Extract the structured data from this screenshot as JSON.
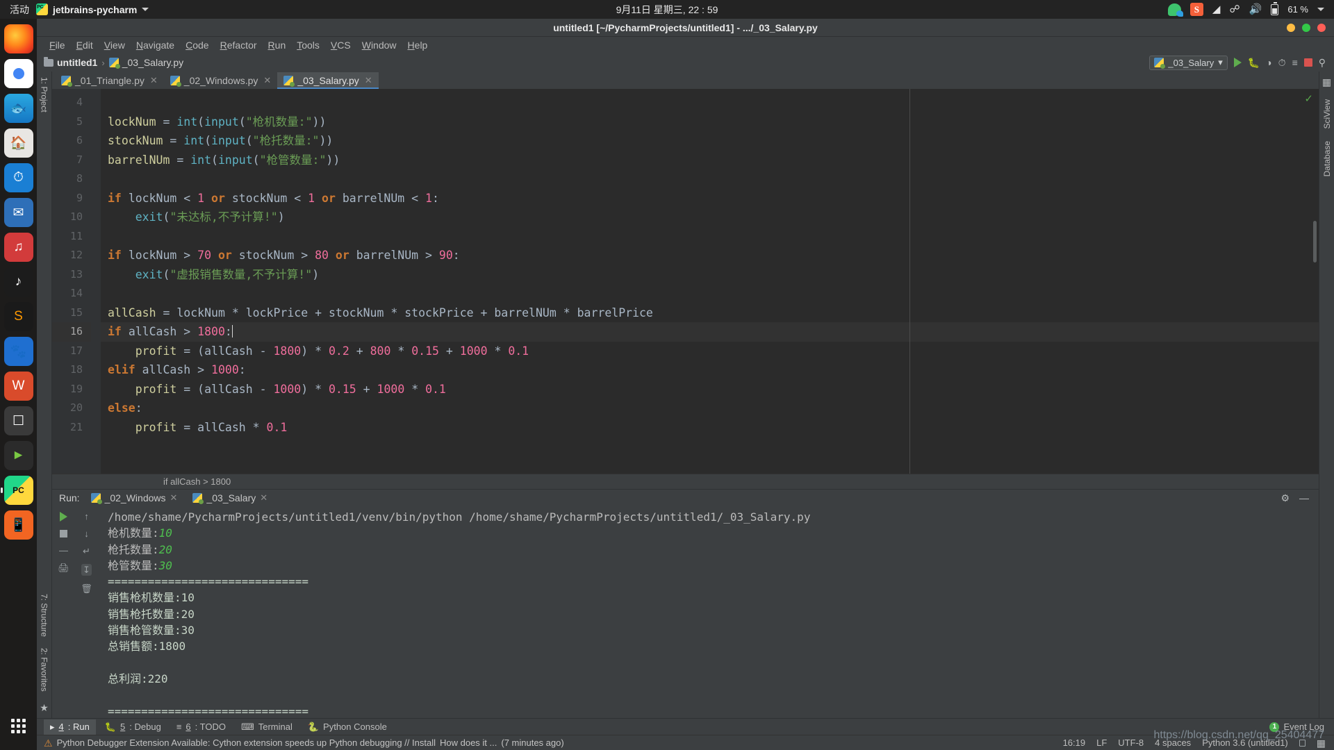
{
  "desktop": {
    "activities": "活动",
    "app_name": "jetbrains-pycharm",
    "clock": "9月11日 星期三, 22 : 59",
    "battery": "61 %",
    "tray": [
      "wechat-icon",
      "sogou-icon",
      "wifi-icon",
      "bluetooth-icon",
      "volume-icon",
      "battery-icon"
    ]
  },
  "dock": {
    "items": [
      {
        "name": "firefox",
        "label": "Firefox"
      },
      {
        "name": "chrome",
        "label": "Google Chrome"
      },
      {
        "name": "dolphin",
        "label": "Dolphin"
      },
      {
        "name": "files",
        "label": "Files"
      },
      {
        "name": "thunder",
        "label": "Thunder"
      },
      {
        "name": "mail",
        "label": "Mail"
      },
      {
        "name": "music",
        "label": "Music"
      },
      {
        "name": "netease",
        "label": "NetEase Music"
      },
      {
        "name": "sublime",
        "label": "Sublime Text"
      },
      {
        "name": "eagle",
        "label": "Eagle"
      },
      {
        "name": "wps",
        "label": "WPS"
      },
      {
        "name": "screenshot",
        "label": "Screenshot"
      },
      {
        "name": "video",
        "label": "Video Player"
      },
      {
        "name": "pycharm",
        "label": "PyCharm"
      },
      {
        "name": "xiaomi",
        "label": "Mi"
      }
    ],
    "show_apps": "Show Applications"
  },
  "ide": {
    "title": "untitled1 [~/PycharmProjects/untitled1] - .../_03_Salary.py",
    "menu": [
      "File",
      "Edit",
      "View",
      "Navigate",
      "Code",
      "Refactor",
      "Run",
      "Tools",
      "VCS",
      "Window",
      "Help"
    ],
    "breadcrumb": {
      "project": "untitled1",
      "file": "_03_Salary.py",
      "separator": "›"
    },
    "run_config": {
      "name": "_03_Salary",
      "caret": "▾"
    },
    "toolbar_icons": [
      "run-icon",
      "debug-icon",
      "coverage-icon",
      "profile-icon",
      "run-with-args-icon",
      "stop-icon",
      "search-icon"
    ],
    "left_strip": {
      "top": "1: Project",
      "bottom_structure": "7: Structure",
      "bottom_favorites": "2: Favorites"
    },
    "right_strip": [
      "SciView",
      "Database"
    ],
    "editor_tabs": [
      {
        "label": "_01_Triangle.py",
        "active": false
      },
      {
        "label": "_02_Windows.py",
        "active": false
      },
      {
        "label": "_03_Salary.py",
        "active": true
      }
    ],
    "editor_breadcrumb": "if allCash > 1800"
  },
  "code": {
    "first_line_number": 4,
    "current_line": 16,
    "lines": [
      {
        "n": 4,
        "tokens": []
      },
      {
        "n": 5,
        "tokens": [
          {
            "t": "lockNum ",
            "c": "varl"
          },
          {
            "t": "= ",
            "c": "op"
          },
          {
            "t": "int",
            "c": "fn"
          },
          {
            "t": "(",
            "c": "op"
          },
          {
            "t": "input",
            "c": "fn"
          },
          {
            "t": "(",
            "c": "op"
          },
          {
            "t": "\"枪机数量:\"",
            "c": "str"
          },
          {
            "t": "))",
            "c": "op"
          }
        ]
      },
      {
        "n": 6,
        "tokens": [
          {
            "t": "stockNum ",
            "c": "varl"
          },
          {
            "t": "= ",
            "c": "op"
          },
          {
            "t": "int",
            "c": "fn"
          },
          {
            "t": "(",
            "c": "op"
          },
          {
            "t": "input",
            "c": "fn"
          },
          {
            "t": "(",
            "c": "op"
          },
          {
            "t": "\"枪托数量:\"",
            "c": "str"
          },
          {
            "t": "))",
            "c": "op"
          }
        ]
      },
      {
        "n": 7,
        "tokens": [
          {
            "t": "barrelNUm ",
            "c": "varl"
          },
          {
            "t": "= ",
            "c": "op"
          },
          {
            "t": "int",
            "c": "fn"
          },
          {
            "t": "(",
            "c": "op"
          },
          {
            "t": "input",
            "c": "fn"
          },
          {
            "t": "(",
            "c": "op"
          },
          {
            "t": "\"枪管数量:\"",
            "c": "str"
          },
          {
            "t": "))",
            "c": "op"
          }
        ]
      },
      {
        "n": 8,
        "tokens": []
      },
      {
        "n": 9,
        "tokens": [
          {
            "t": "if ",
            "c": "kw"
          },
          {
            "t": "lockNum ",
            "c": "var"
          },
          {
            "t": "< ",
            "c": "op"
          },
          {
            "t": "1 ",
            "c": "num"
          },
          {
            "t": "or ",
            "c": "kw"
          },
          {
            "t": "stockNum ",
            "c": "var"
          },
          {
            "t": "< ",
            "c": "op"
          },
          {
            "t": "1 ",
            "c": "num"
          },
          {
            "t": "or ",
            "c": "kw"
          },
          {
            "t": "barrelNUm ",
            "c": "var"
          },
          {
            "t": "< ",
            "c": "op"
          },
          {
            "t": "1",
            "c": "num"
          },
          {
            "t": ":",
            "c": "op"
          }
        ]
      },
      {
        "n": 10,
        "indent": 4,
        "tokens": [
          {
            "t": "exit",
            "c": "fn"
          },
          {
            "t": "(",
            "c": "op"
          },
          {
            "t": "\"未达标,不予计算!\"",
            "c": "str"
          },
          {
            "t": ")",
            "c": "op"
          }
        ]
      },
      {
        "n": 11,
        "tokens": []
      },
      {
        "n": 12,
        "tokens": [
          {
            "t": "if ",
            "c": "kw"
          },
          {
            "t": "lockNum ",
            "c": "var"
          },
          {
            "t": "> ",
            "c": "op"
          },
          {
            "t": "70 ",
            "c": "num"
          },
          {
            "t": "or ",
            "c": "kw"
          },
          {
            "t": "stockNum ",
            "c": "var"
          },
          {
            "t": "> ",
            "c": "op"
          },
          {
            "t": "80 ",
            "c": "num"
          },
          {
            "t": "or ",
            "c": "kw"
          },
          {
            "t": "barrelNUm ",
            "c": "var"
          },
          {
            "t": "> ",
            "c": "op"
          },
          {
            "t": "90",
            "c": "num"
          },
          {
            "t": ":",
            "c": "op"
          }
        ]
      },
      {
        "n": 13,
        "indent": 4,
        "tokens": [
          {
            "t": "exit",
            "c": "fn"
          },
          {
            "t": "(",
            "c": "op"
          },
          {
            "t": "\"虚报销售数量,不予计算!\"",
            "c": "str"
          },
          {
            "t": ")",
            "c": "op"
          }
        ]
      },
      {
        "n": 14,
        "tokens": []
      },
      {
        "n": 15,
        "tokens": [
          {
            "t": "allCash ",
            "c": "varl"
          },
          {
            "t": "= ",
            "c": "op"
          },
          {
            "t": "lockNum ",
            "c": "var"
          },
          {
            "t": "* ",
            "c": "op"
          },
          {
            "t": "lockPrice ",
            "c": "var"
          },
          {
            "t": "+ ",
            "c": "op"
          },
          {
            "t": "stockNum ",
            "c": "var"
          },
          {
            "t": "* ",
            "c": "op"
          },
          {
            "t": "stockPrice ",
            "c": "var"
          },
          {
            "t": "+ ",
            "c": "op"
          },
          {
            "t": "barrelNUm ",
            "c": "var"
          },
          {
            "t": "* ",
            "c": "op"
          },
          {
            "t": "barrelPrice",
            "c": "var"
          }
        ]
      },
      {
        "n": 16,
        "current": true,
        "caret": true,
        "tokens": [
          {
            "t": "if ",
            "c": "kw"
          },
          {
            "t": "allCash ",
            "c": "var"
          },
          {
            "t": "> ",
            "c": "op"
          },
          {
            "t": "1800",
            "c": "num"
          },
          {
            "t": ":",
            "c": "op"
          }
        ]
      },
      {
        "n": 17,
        "indent": 4,
        "tokens": [
          {
            "t": "profit ",
            "c": "varl"
          },
          {
            "t": "= ",
            "c": "op"
          },
          {
            "t": "(",
            "c": "op"
          },
          {
            "t": "allCash ",
            "c": "var"
          },
          {
            "t": "- ",
            "c": "op"
          },
          {
            "t": "1800",
            "c": "num"
          },
          {
            "t": ") ",
            "c": "op"
          },
          {
            "t": "* ",
            "c": "op"
          },
          {
            "t": "0.2 ",
            "c": "num"
          },
          {
            "t": "+ ",
            "c": "op"
          },
          {
            "t": "800 ",
            "c": "num"
          },
          {
            "t": "* ",
            "c": "op"
          },
          {
            "t": "0.15 ",
            "c": "num"
          },
          {
            "t": "+ ",
            "c": "op"
          },
          {
            "t": "1000 ",
            "c": "num"
          },
          {
            "t": "* ",
            "c": "op"
          },
          {
            "t": "0.1",
            "c": "num"
          }
        ]
      },
      {
        "n": 18,
        "tokens": [
          {
            "t": "elif ",
            "c": "kw"
          },
          {
            "t": "allCash ",
            "c": "var"
          },
          {
            "t": "> ",
            "c": "op"
          },
          {
            "t": "1000",
            "c": "num"
          },
          {
            "t": ":",
            "c": "op"
          }
        ]
      },
      {
        "n": 19,
        "indent": 4,
        "tokens": [
          {
            "t": "profit ",
            "c": "varl"
          },
          {
            "t": "= ",
            "c": "op"
          },
          {
            "t": "(",
            "c": "op"
          },
          {
            "t": "allCash ",
            "c": "var"
          },
          {
            "t": "- ",
            "c": "op"
          },
          {
            "t": "1000",
            "c": "num"
          },
          {
            "t": ") ",
            "c": "op"
          },
          {
            "t": "* ",
            "c": "op"
          },
          {
            "t": "0.15 ",
            "c": "num"
          },
          {
            "t": "+ ",
            "c": "op"
          },
          {
            "t": "1000 ",
            "c": "num"
          },
          {
            "t": "* ",
            "c": "op"
          },
          {
            "t": "0.1",
            "c": "num"
          }
        ]
      },
      {
        "n": 20,
        "tokens": [
          {
            "t": "else",
            "c": "kw"
          },
          {
            "t": ":",
            "c": "op"
          }
        ]
      },
      {
        "n": 21,
        "indent": 4,
        "tokens": [
          {
            "t": "profit ",
            "c": "varl"
          },
          {
            "t": "= ",
            "c": "op"
          },
          {
            "t": "allCash ",
            "c": "var"
          },
          {
            "t": "* ",
            "c": "op"
          },
          {
            "t": "0.1",
            "c": "num"
          }
        ]
      }
    ]
  },
  "run": {
    "label": "Run:",
    "tabs": [
      {
        "label": "_02_Windows",
        "active": false
      },
      {
        "label": "_03_Salary",
        "active": true
      }
    ],
    "console_lines": [
      {
        "kind": "path",
        "text": "/home/shame/PycharmProjects/untitled1/venv/bin/python /home/shame/PycharmProjects/untitled1/_03_Salary.py"
      },
      {
        "kind": "prompt",
        "prompt": "枪机数量:",
        "value": "10"
      },
      {
        "kind": "prompt",
        "prompt": "枪托数量:",
        "value": "20"
      },
      {
        "kind": "prompt",
        "prompt": "枪管数量:",
        "value": "30"
      },
      {
        "kind": "out",
        "text": "=============================="
      },
      {
        "kind": "out",
        "text": "销售枪机数量:10"
      },
      {
        "kind": "out",
        "text": "销售枪托数量:20"
      },
      {
        "kind": "out",
        "text": "销售枪管数量:30"
      },
      {
        "kind": "out",
        "text": "总销售额:1800"
      },
      {
        "kind": "out",
        "text": ""
      },
      {
        "kind": "out",
        "text": "总利润:220"
      },
      {
        "kind": "out",
        "text": ""
      },
      {
        "kind": "out",
        "text": "=============================="
      }
    ]
  },
  "bottom_windows": [
    {
      "num": "4",
      "label": ": Run",
      "active": true,
      "icon": "run-icon"
    },
    {
      "num": "5",
      "label": ": Debug",
      "active": false,
      "icon": "debug-icon"
    },
    {
      "num": "6",
      "label": ": TODO",
      "active": false,
      "icon": "todo-icon"
    },
    {
      "num": "",
      "label": "Terminal",
      "active": false,
      "icon": "terminal-icon"
    },
    {
      "num": "",
      "label": "Python Console",
      "active": false,
      "icon": "python-icon"
    }
  ],
  "event_log": {
    "count": "1",
    "label": "Event Log"
  },
  "status": {
    "message": "Python Debugger Extension Available: Cython extension speeds up Python debugging // Install",
    "hint": "How does it ...",
    "time_ago": "(7 minutes ago)",
    "position": "16:19",
    "line_sep": "LF",
    "encoding": "UTF-8",
    "indent": "4 spaces",
    "interpreter": "Python 3.6 (untitled1)"
  },
  "watermark": "https://blog.csdn.net/qq_25404477",
  "colors": {
    "ide_bg": "#3c3f41",
    "editor_bg": "#2b2b2b",
    "accent_blue": "#4a88c7",
    "keyword": "#cc7832",
    "number": "#f06e9c",
    "string": "#6a9c55",
    "function": "#5fb3c4",
    "run_green": "#5fad4e",
    "stop_red": "#d9534f"
  }
}
